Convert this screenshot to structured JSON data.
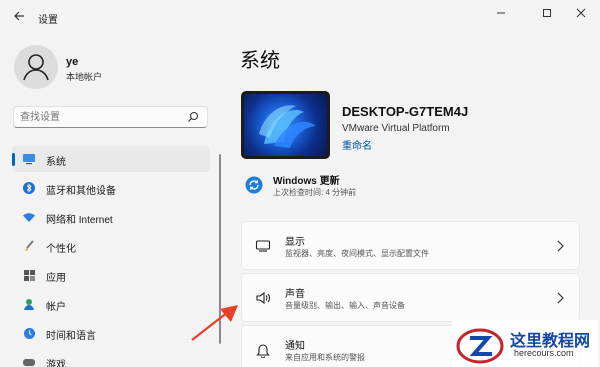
{
  "window": {
    "title": "设置"
  },
  "profile": {
    "name": "ye",
    "account_type": "本地帐户"
  },
  "search": {
    "placeholder": "查找设置"
  },
  "sidebar": {
    "items": [
      {
        "label": "系统",
        "icon": "monitor-icon",
        "active": true
      },
      {
        "label": "蓝牙和其他设备",
        "icon": "bluetooth-icon",
        "active": false
      },
      {
        "label": "网络和 Internet",
        "icon": "wifi-icon",
        "active": false
      },
      {
        "label": "个性化",
        "icon": "brush-icon",
        "active": false
      },
      {
        "label": "应用",
        "icon": "apps-icon",
        "active": false
      },
      {
        "label": "帐户",
        "icon": "person-icon",
        "active": false
      },
      {
        "label": "时间和语言",
        "icon": "globe-clock-icon",
        "active": false
      },
      {
        "label": "游戏",
        "icon": "gamepad-icon",
        "active": false
      }
    ]
  },
  "main": {
    "title": "系统",
    "device": {
      "name": "DESKTOP-G7TEM4J",
      "model": "VMware Virtual Platform",
      "rename_label": "重命名"
    },
    "update": {
      "title": "Windows 更新",
      "subtitle": "上次检查时间: 4 分钟前"
    },
    "cards": [
      {
        "title": "显示",
        "subtitle": "监视器、亮度、夜间模式、显示配置文件",
        "icon": "display-icon"
      },
      {
        "title": "声音",
        "subtitle": "音量级别、输出、输入、声音设备",
        "icon": "speaker-icon"
      },
      {
        "title": "通知",
        "subtitle": "来自应用和系统的警报",
        "icon": "bell-icon"
      }
    ]
  },
  "watermark": {
    "line1": "这里教程网",
    "line2": "herecours.com"
  },
  "colors": {
    "accent": "#0067c0",
    "background": "#f3f3f3",
    "annotation_arrow": "#e8402a"
  }
}
